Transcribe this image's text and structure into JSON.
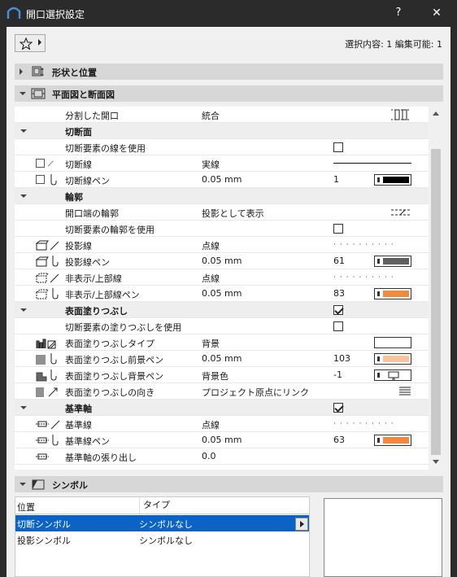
{
  "window": {
    "title": "開口選択設定",
    "help": "?",
    "close": "✕"
  },
  "selection": {
    "info": "選択内容: 1 編集可能: 1"
  },
  "sections": {
    "shape": "形状と位置",
    "plan": "平面図と断面図",
    "symbol": "シンボル"
  },
  "rows": [
    {
      "label": "分割した開口",
      "value": "統合",
      "kind": "text"
    },
    {
      "label": "切断面",
      "kind": "group"
    },
    {
      "label": "切断要素の線を使用",
      "kind": "check",
      "checked": false
    },
    {
      "label": "切断線",
      "value": "実線",
      "kind": "solidline"
    },
    {
      "label": "切断線ペン",
      "value": "0.05 mm",
      "pen": "1",
      "color": "#000000",
      "kind": "pen"
    },
    {
      "label": "輪郭",
      "kind": "group"
    },
    {
      "label": "開口端の輪郭",
      "value": "投影として表示",
      "kind": "text"
    },
    {
      "label": "切断要素の輪郭を使用",
      "kind": "check",
      "checked": false
    },
    {
      "label": "投影線",
      "value": "点線",
      "kind": "dotline"
    },
    {
      "label": "投影線ペン",
      "value": "0.05 mm",
      "pen": "61",
      "color": "#5f5f5f",
      "kind": "pen"
    },
    {
      "label": "非表示/上部線",
      "value": "点線",
      "kind": "dotline"
    },
    {
      "label": "非表示/上部線ペン",
      "value": "0.05 mm",
      "pen": "83",
      "color": "#f58a3c",
      "kind": "pen"
    },
    {
      "label": "表面塗りつぶし",
      "kind": "groupcheck",
      "checked": true
    },
    {
      "label": "切断要素の塗りつぶしを使用",
      "kind": "check",
      "checked": false
    },
    {
      "label": "表面塗りつぶしタイプ",
      "value": "背景",
      "kind": "fillbox"
    },
    {
      "label": "表面塗りつぶし前景ペン",
      "value": "0.05 mm",
      "pen": "103",
      "color": "#f9c39d",
      "kind": "pen"
    },
    {
      "label": "表面塗りつぶし背景ペン",
      "value": "背景色",
      "pen": "-1",
      "color": "#ffffff",
      "kind": "monitor"
    },
    {
      "label": "表面塗りつぶしの向き",
      "value": "プロジェクト原点にリンク",
      "kind": "hatch"
    },
    {
      "label": "基準軸",
      "kind": "groupcheck",
      "checked": true
    },
    {
      "label": "基準線",
      "value": "点線",
      "kind": "dotline"
    },
    {
      "label": "基準線ペン",
      "value": "0.05 mm",
      "pen": "63",
      "color": "#f5883a",
      "kind": "pen"
    },
    {
      "label": "基準軸の張り出し",
      "value": "0.0",
      "kind": "text"
    }
  ],
  "symbols": {
    "headers": [
      "位置",
      "タイプ"
    ],
    "rows": [
      {
        "position": "切断シンボル",
        "type": "シンボルなし",
        "selected": true
      },
      {
        "position": "投影シンボル",
        "type": "シンボルなし",
        "selected": false
      }
    ]
  }
}
